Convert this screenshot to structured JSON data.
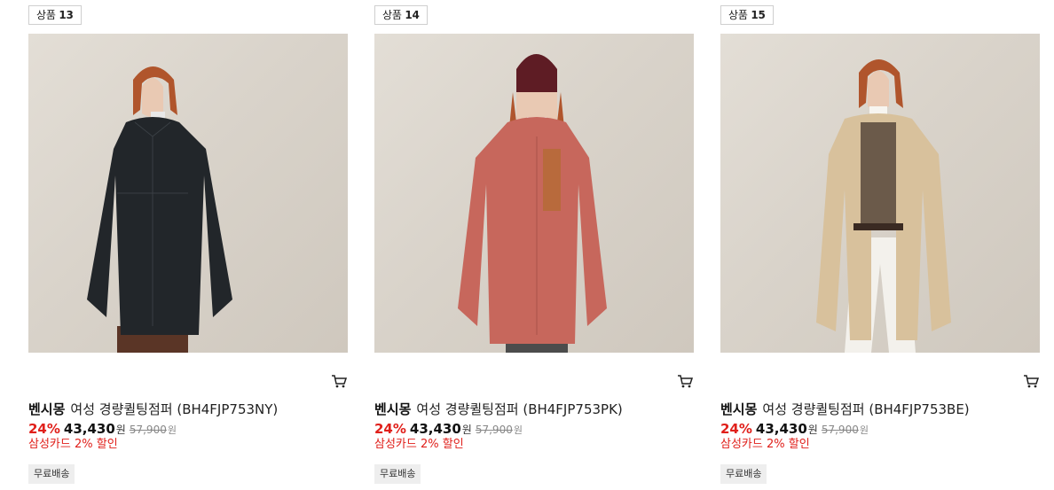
{
  "products": [
    {
      "rank_label": "상품",
      "rank_number": "13",
      "image_alt": "woman wearing black quilted long jacket",
      "brand": "벤시몽",
      "name": "여성 경량퀼팅점퍼 (BH4FJP753NY)",
      "discount_rate": "24%",
      "price": "43,430",
      "currency": "원",
      "original_price": "57,900",
      "original_currency": "원",
      "card_discount": "삼성카드 2% 할인",
      "shipping_badge": "무료배송",
      "coat_color": "#22262a"
    },
    {
      "rank_label": "상품",
      "rank_number": "14",
      "image_alt": "woman wearing pink quilted long jacket and burgundy beanie",
      "brand": "벤시몽",
      "name": "여성 경량퀼팅점퍼 (BH4FJP753PK)",
      "discount_rate": "24%",
      "price": "43,430",
      "currency": "원",
      "original_price": "57,900",
      "original_currency": "원",
      "card_discount": "삼성카드 2% 할인",
      "shipping_badge": "무료배송",
      "coat_color": "#c7675c"
    },
    {
      "rank_label": "상품",
      "rank_number": "15",
      "image_alt": "woman wearing beige quilted long jacket with plaid shirt",
      "brand": "벤시몽",
      "name": "여성 경량퀼팅점퍼 (BH4FJP753BE)",
      "discount_rate": "24%",
      "price": "43,430",
      "currency": "원",
      "original_price": "57,900",
      "original_currency": "원",
      "card_discount": "삼성카드 2% 할인",
      "shipping_badge": "무료배송",
      "coat_color": "#d8c19c"
    }
  ],
  "icons": {
    "cart": "cart-icon"
  },
  "colors": {
    "discount": "#e0201b",
    "badge_bg": "#eeeeee",
    "border": "#cfcfcf"
  }
}
